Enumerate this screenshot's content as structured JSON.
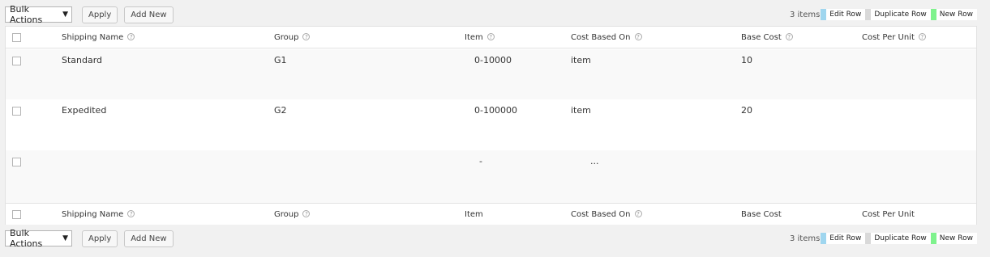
{
  "toolbar": {
    "bulk_actions": "Bulk Actions",
    "apply": "Apply",
    "add_new": "Add New",
    "items_count": "3 items",
    "legend": [
      {
        "label": "Edit Row",
        "color": "#9fd6ef"
      },
      {
        "label": "Duplicate Row",
        "color": "#d9d9d9"
      },
      {
        "label": "New Row",
        "color": "#7ff28d"
      }
    ]
  },
  "columns": [
    {
      "label": "Shipping Name",
      "help": true
    },
    {
      "label": "Group",
      "help": true
    },
    {
      "label": "Item",
      "help": true
    },
    {
      "label": "Cost Based On",
      "help": true
    },
    {
      "label": "Base Cost",
      "help": true
    },
    {
      "label": "Cost Per Unit",
      "help": true
    }
  ],
  "footer_columns": [
    {
      "label": "Shipping Name",
      "help": true
    },
    {
      "label": "Group",
      "help": true
    },
    {
      "label": "Item",
      "help": false
    },
    {
      "label": "Cost Based On",
      "help": true
    },
    {
      "label": "Base Cost",
      "help": false
    },
    {
      "label": "Cost Per Unit",
      "help": false
    }
  ],
  "rows": [
    {
      "name": "Standard",
      "group": "G1",
      "item": "0-10000",
      "cost_based_on": "item",
      "base_cost": "10",
      "cost_per_unit": ""
    },
    {
      "name": "Expedited",
      "group": "G2",
      "item": "0-100000",
      "cost_based_on": "item",
      "base_cost": "20",
      "cost_per_unit": ""
    },
    {
      "name": "",
      "group": "",
      "item": "-",
      "cost_based_on": "...",
      "base_cost": "",
      "cost_per_unit": ""
    }
  ]
}
